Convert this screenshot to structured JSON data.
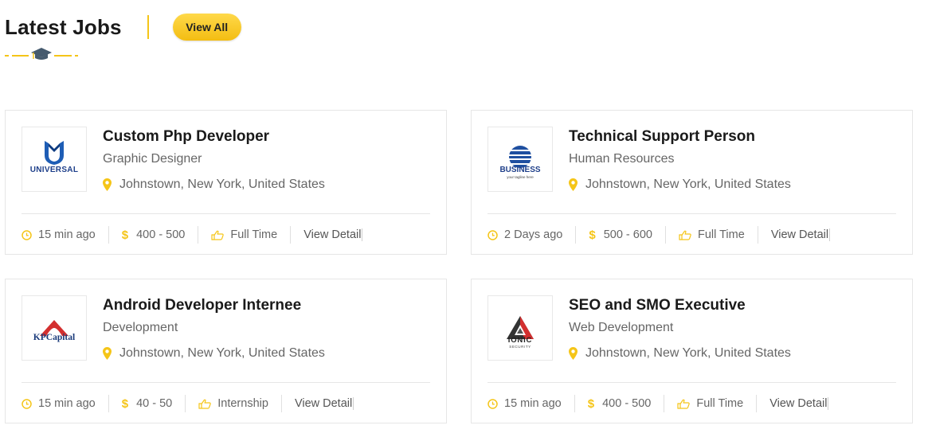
{
  "section": {
    "title": "Latest Jobs",
    "view_all_label": "View All",
    "accent_color": "#f5c518"
  },
  "jobs": [
    {
      "title": "Custom Php Developer",
      "category": "Graphic Designer",
      "location": "Johnstown, New York, United States",
      "posted": "15 min ago",
      "salary": "400 - 500",
      "type": "Full Time",
      "detail_label": "View Detail",
      "logo": {
        "name": "UNIVERSAL",
        "icon": "universal-logo"
      }
    },
    {
      "title": "Technical Support Person",
      "category": "Human Resources",
      "location": "Johnstown, New York, United States",
      "posted": "2 Days ago",
      "salary": "500 - 600",
      "type": "Full Time",
      "detail_label": "View Detail",
      "logo": {
        "name": "BUSINESS",
        "tagline": "your tagline here",
        "icon": "business-globe-logo"
      }
    },
    {
      "title": "Android Developer Internee",
      "category": "Development",
      "location": "Johnstown, New York, United States",
      "posted": "15 min ago",
      "salary": "40 - 50",
      "type": "Internship",
      "detail_label": "View Detail",
      "logo": {
        "name": "KPCapital",
        "icon": "kpcapital-logo"
      }
    },
    {
      "title": "SEO and SMO Executive",
      "category": "Web Development",
      "location": "Johnstown, New York, United States",
      "posted": "15 min ago",
      "salary": "400 - 500",
      "type": "Full Time",
      "detail_label": "View Detail",
      "logo": {
        "name": "IONIC",
        "tagline": "SECURITY",
        "icon": "ionic-security-logo"
      }
    }
  ]
}
